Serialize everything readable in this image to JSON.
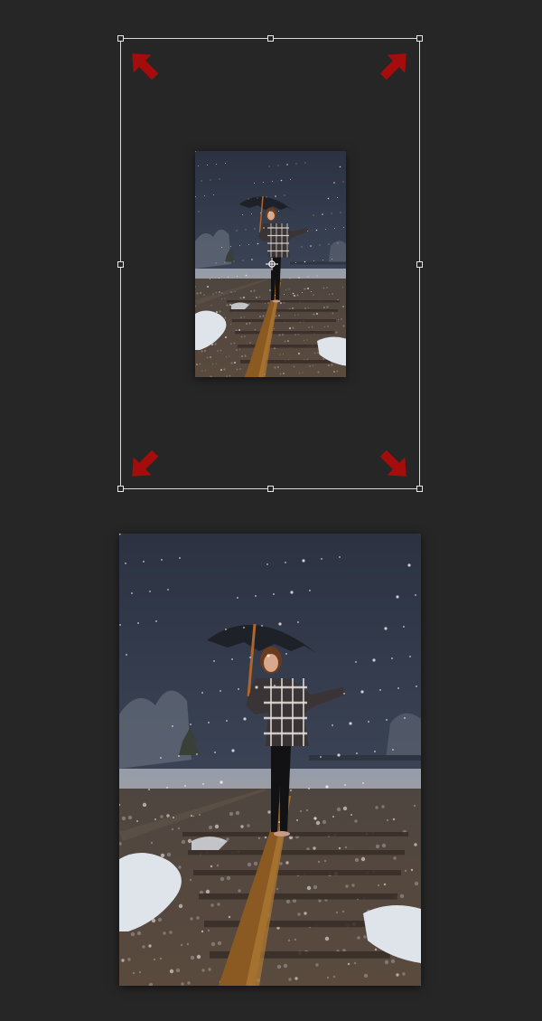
{
  "app": {
    "background_color": "#262626"
  },
  "transform": {
    "frame_color": "#d8d8d8",
    "arrow_color": "#a50d0d",
    "handles": [
      "top-left",
      "top-center",
      "top-right",
      "middle-left",
      "middle-right",
      "bottom-left",
      "bottom-center",
      "bottom-right"
    ],
    "arrows": [
      "arrow-up-left-icon",
      "arrow-up-right-icon",
      "arrow-down-left-icon",
      "arrow-down-right-icon"
    ]
  },
  "photo": {
    "subject": "woman-with-umbrella-on-rail-track",
    "sky_color": "#3b4456",
    "ground_color": "#5a4a3e",
    "snow_color": "#dfe3ea",
    "rail_color": "#8a5a22"
  }
}
